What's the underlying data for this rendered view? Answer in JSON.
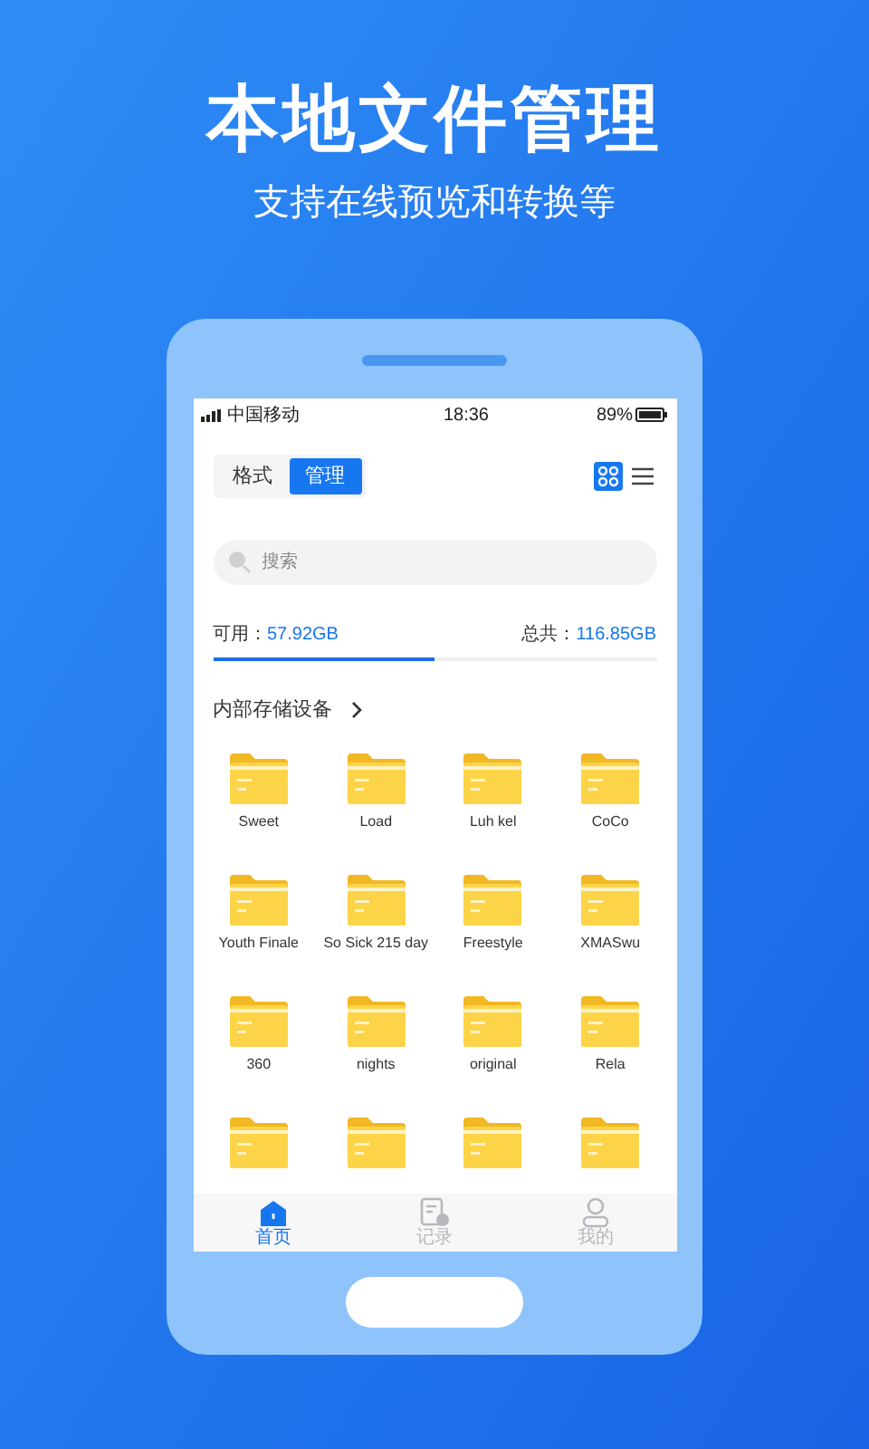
{
  "headline": "本地文件管理",
  "subheadline": "支持在线预览和转换等",
  "status_bar": {
    "carrier": "中国移动",
    "time": "18:36",
    "battery": "89%"
  },
  "segments": [
    {
      "label": "格式",
      "selected": false
    },
    {
      "label": "管理",
      "selected": true
    }
  ],
  "view_toggle": [
    {
      "kind": "grid",
      "selected": true
    },
    {
      "kind": "list",
      "selected": false
    }
  ],
  "search": {
    "placeholder": "搜索"
  },
  "storage": {
    "available_label": "可用：",
    "available": "57.92GB",
    "total_label": "总共：",
    "total": "116.85GB",
    "level": 0.5
  },
  "section": {
    "title": "内部存储设备"
  },
  "folders": [
    {
      "kind": "folder",
      "name": "Sweet"
    },
    {
      "kind": "folder",
      "name": "Load"
    },
    {
      "kind": "folder",
      "name": "Luh kel"
    },
    {
      "kind": "folder",
      "name": "CoCo"
    },
    {
      "kind": "folder",
      "name": "Youth Finale"
    },
    {
      "kind": "folder",
      "name": "So Sick 215 day"
    },
    {
      "kind": "folder",
      "name": "Freestyle"
    },
    {
      "kind": "folder",
      "name": "XMASwu"
    },
    {
      "kind": "folder",
      "name": "360"
    },
    {
      "kind": "folder",
      "name": "nights"
    },
    {
      "kind": "folder",
      "name": "original"
    },
    {
      "kind": "folder",
      "name": "Rela"
    },
    {
      "kind": "folder"
    },
    {
      "kind": "folder"
    },
    {
      "kind": "folder"
    },
    {
      "kind": "folder"
    }
  ],
  "tab_bar": [
    {
      "kind": "home",
      "label": "首页",
      "selected": true
    },
    {
      "kind": "records",
      "label": "记录",
      "selected": false
    },
    {
      "kind": "profile",
      "label": "我的",
      "selected": false
    }
  ]
}
